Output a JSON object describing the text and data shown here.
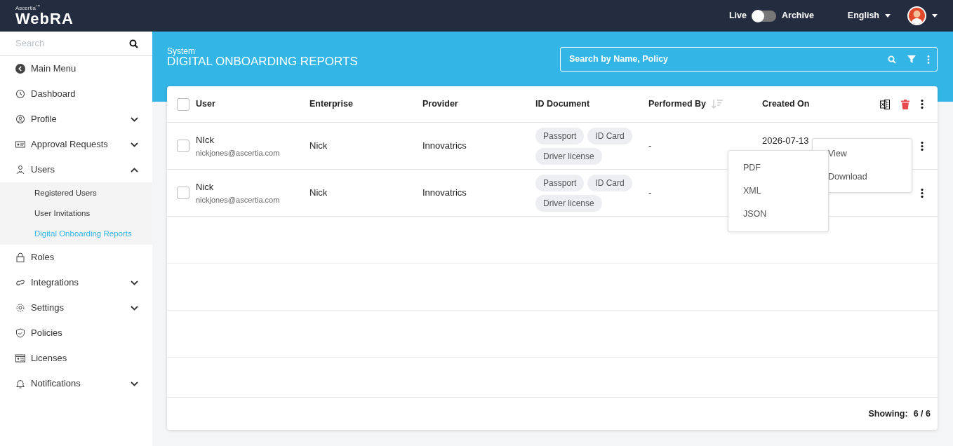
{
  "topbar": {
    "brand_mark": "Ascertia$^{™}$",
    "brand": "WebRA",
    "toggle": {
      "left_label": "Live",
      "right_label": "Archive",
      "on": false
    },
    "language": "English"
  },
  "sidebar": {
    "search_placeholder": "Search",
    "back": "Main Menu",
    "items": [
      {
        "label": "Dashboard",
        "kind": "link"
      },
      {
        "label": "Profile",
        "kind": "group",
        "expanded": false
      },
      {
        "label": "Approval Requests",
        "kind": "group",
        "expanded": false
      },
      {
        "label": "Users",
        "kind": "group",
        "expanded": true,
        "children": [
          {
            "label": "Registered Users",
            "selected": false
          },
          {
            "label": "User Invitations",
            "selected": false
          },
          {
            "label": "Digital Onboarding Reports",
            "selected": true
          }
        ]
      },
      {
        "label": "Roles",
        "kind": "link"
      },
      {
        "label": "Integrations",
        "kind": "group",
        "expanded": false
      },
      {
        "label": "Settings",
        "kind": "group",
        "expanded": false
      },
      {
        "label": "Policies",
        "kind": "link"
      },
      {
        "label": "Licenses",
        "kind": "link"
      },
      {
        "label": "Notifications",
        "kind": "group",
        "expanded": false
      }
    ]
  },
  "page": {
    "section": "System",
    "title": "DIGITAL ONBOARDING REPORTS",
    "search_placeholder": "Search by Name, Policy"
  },
  "table": {
    "all_selected": false,
    "columns": [
      {
        "label": "User",
        "sortable": false
      },
      {
        "label": "Enterprise",
        "sortable": false
      },
      {
        "label": "Provider",
        "sortable": false
      },
      {
        "label": "ID Document",
        "sortable": false
      },
      {
        "label": "Performed By",
        "sortable": true
      },
      {
        "label": "Created On",
        "sortable": false
      }
    ],
    "rows": [
      {
        "selected": false,
        "name": "NIck",
        "email": "nickjones@ascertia.com",
        "enterprise": "Nick",
        "provider": "Innovatrics",
        "documents": [
          "Passport",
          "ID Card",
          "Driver license"
        ],
        "performed_by": "-",
        "created_on": "2026-07-13"
      },
      {
        "selected": false,
        "name": "Nick",
        "email": "nickjones@ascertia.com",
        "enterprise": "Nick",
        "provider": "Innovatrics",
        "documents": [
          "Passport",
          "ID Card",
          "Driver license"
        ],
        "performed_by": "-",
        "created_on": ""
      }
    ],
    "footer": {
      "label": "Showing:",
      "value": "6 / 6"
    }
  },
  "row_menu": {
    "items": [
      "View",
      "Download"
    ]
  },
  "export_menu": {
    "items": [
      "PDF",
      "XML",
      "JSON"
    ]
  }
}
